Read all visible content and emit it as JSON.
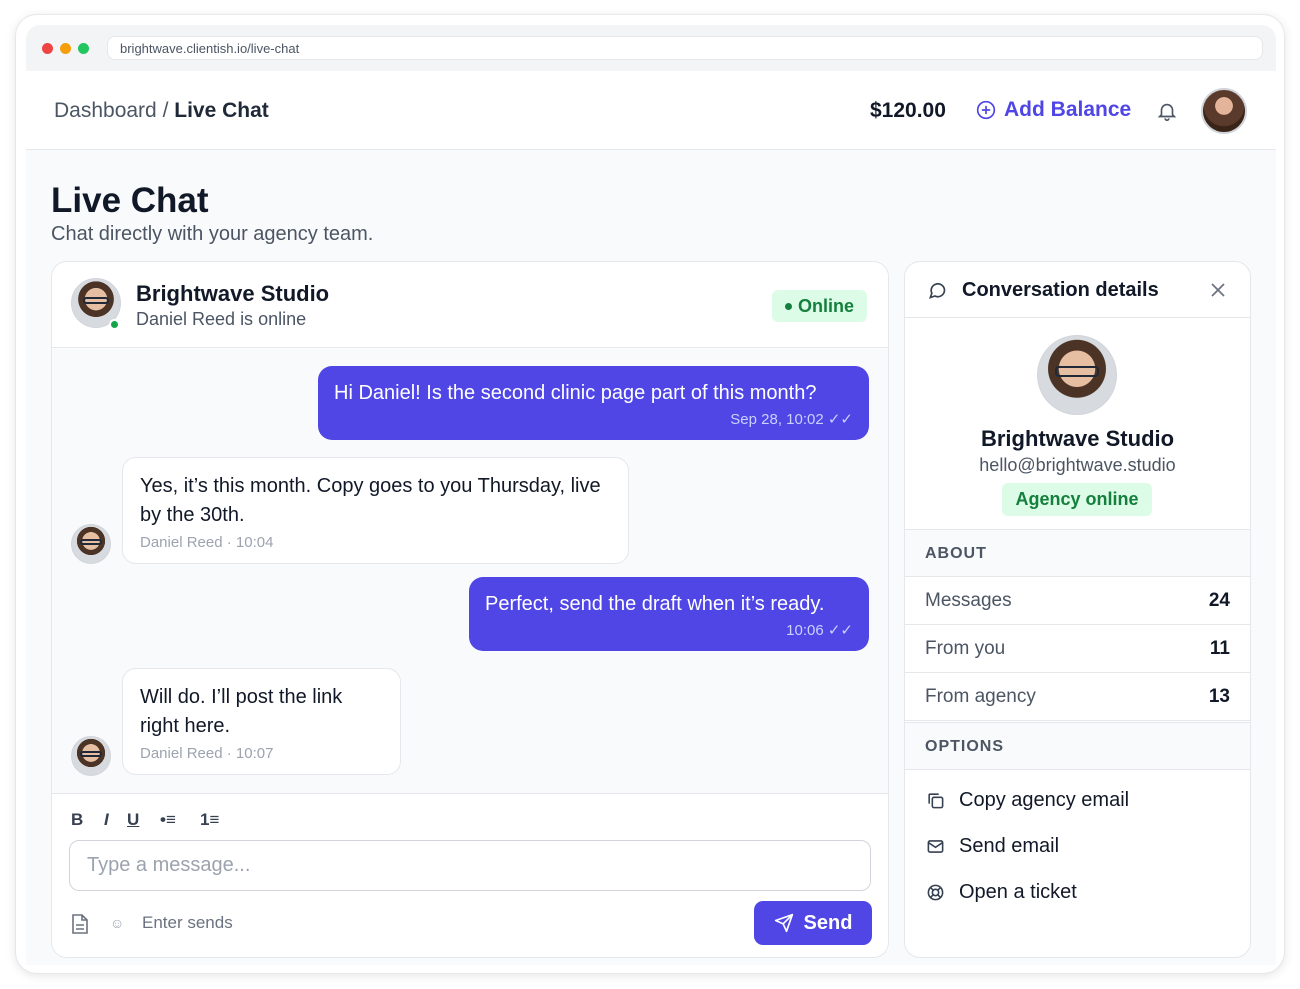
{
  "browser": {
    "url": "brightwave.clientish.io/live-chat"
  },
  "topbar": {
    "breadcrumb_parent": "Dashboard",
    "breadcrumb_sep": "/",
    "breadcrumb_current": "Live Chat",
    "balance": "$120.00",
    "add_balance_label": "Add Balance"
  },
  "page": {
    "title": "Live Chat",
    "subtitle": "Chat directly with your agency team."
  },
  "chat": {
    "name": "Brightwave Studio",
    "status": "Daniel Reed is online",
    "badge": "Online",
    "messages": [
      {
        "direction": "out",
        "text": "Hi Daniel! Is the second clinic page part of this month?",
        "meta": "Sep 28, 10:02 ✓✓"
      },
      {
        "direction": "in",
        "text": "Yes, it’s this month. Copy goes to you Thursday, live by the 30th.",
        "meta": "Daniel Reed · 10:04"
      },
      {
        "direction": "out",
        "text": "Perfect, send the draft when it’s ready.",
        "meta": "10:06 ✓✓"
      },
      {
        "direction": "in",
        "text": "Will do. I’ll post the link right here.",
        "meta": "Daniel Reed · 10:07"
      }
    ],
    "composer": {
      "bold": "B",
      "italic": "I",
      "underline": "U",
      "bullet_list": "•≡",
      "numbered_list": "1≡",
      "placeholder": "Type a message...",
      "emoji": "☺",
      "hint": "Enter sends",
      "send_label": "Send"
    }
  },
  "details": {
    "title": "Conversation details",
    "name": "Brightwave Studio",
    "email": "hello@brightwave.studio",
    "badge": "Agency online",
    "about_heading": "ABOUT",
    "stats": [
      {
        "label": "Messages",
        "value": "24"
      },
      {
        "label": "From you",
        "value": "11"
      },
      {
        "label": "From agency",
        "value": "13"
      }
    ],
    "options_heading": "OPTIONS",
    "options": [
      {
        "label": "Copy agency email",
        "icon": "copy-icon"
      },
      {
        "label": "Send email",
        "icon": "mail-icon"
      },
      {
        "label": "Open a ticket",
        "icon": "lifebuoy-icon"
      }
    ]
  },
  "colors": {
    "accent": "#4f46e5",
    "online": "#15803d",
    "online_bg": "#dcfce7"
  }
}
